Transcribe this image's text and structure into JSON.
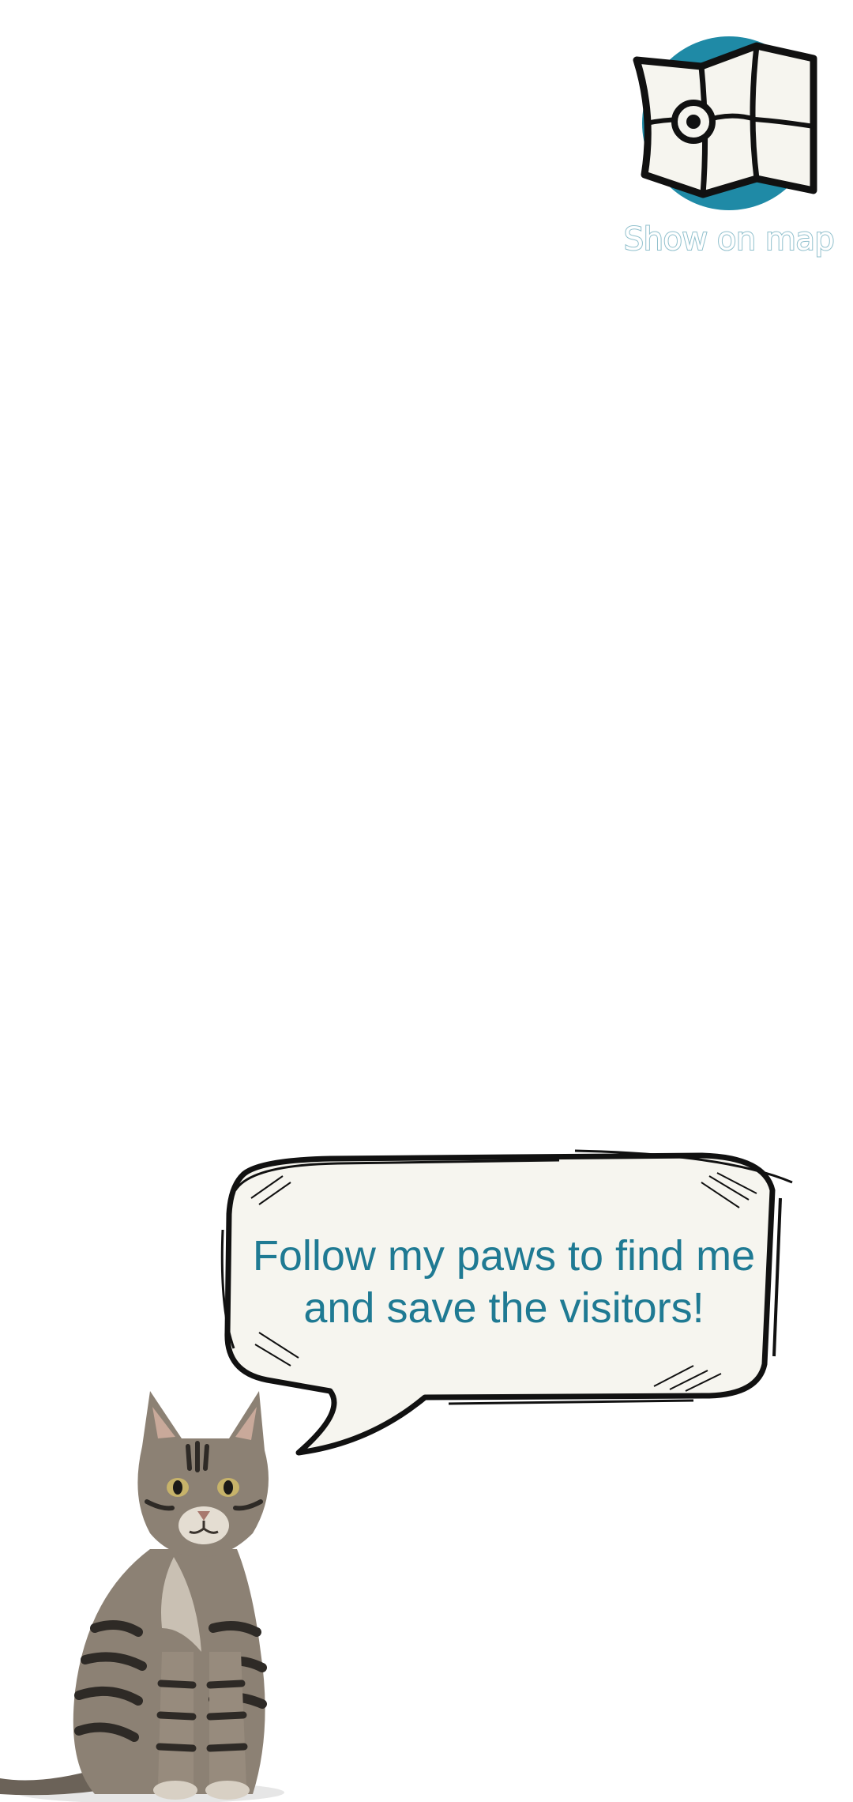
{
  "map_button": {
    "label": "Show on map",
    "icon": "folded-map-icon",
    "circle_color": "#1f8aa6",
    "map_fill": "#f6f5ef",
    "label_outline_color": "#8fbfcc"
  },
  "speech_bubble": {
    "line1": "Follow my paws to find me",
    "line2": "and save the visitors!",
    "text_color": "#1f7a93",
    "fill_color": "#f6f5ef"
  },
  "cat": {
    "icon": "tabby-cat-illustration"
  }
}
